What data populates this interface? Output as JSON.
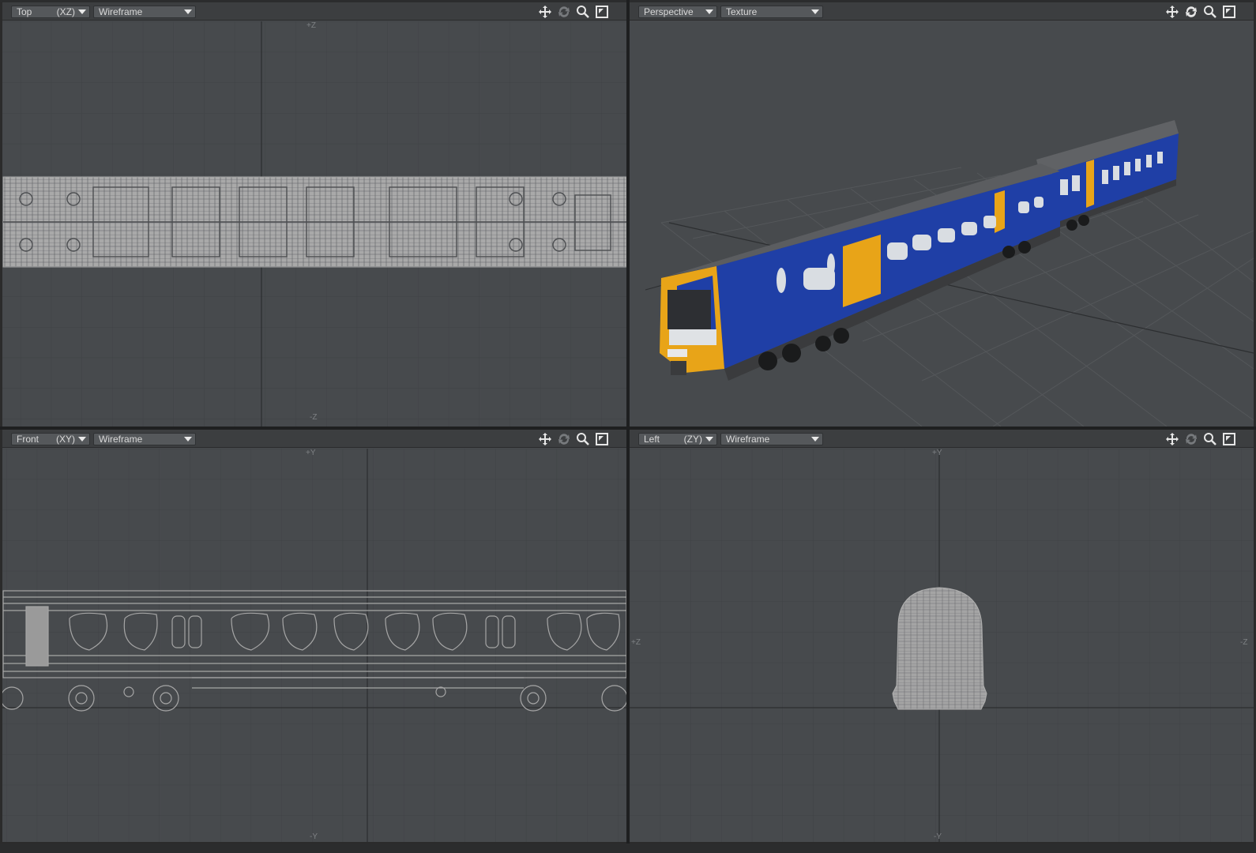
{
  "viewports": {
    "top": {
      "view_label": "Top",
      "projection": "(XZ)",
      "shading": "Wireframe",
      "axis_top": "+Z",
      "axis_bottom": "-Z"
    },
    "perspective": {
      "view_label": "Perspective",
      "shading": "Texture"
    },
    "front": {
      "view_label": "Front",
      "projection": "(XY)",
      "shading": "Wireframe",
      "axis_top": "+Y",
      "axis_bottom": "-Y"
    },
    "left": {
      "view_label": "Left",
      "projection": "(ZY)",
      "shading": "Wireframe",
      "axis_top": "+Y",
      "axis_left": "+Z",
      "axis_right": "-Z",
      "axis_bottom": "-Y"
    }
  },
  "icons": [
    "move-icon",
    "rotate-icon",
    "zoom-icon",
    "maximize-icon"
  ],
  "colors": {
    "viewport_bg": "#474a4d",
    "grid": "#3f4245",
    "wireframe": "#a6a6a6",
    "train_blue": "#1f3fa6",
    "train_yellow": "#e8a418",
    "train_roof": "#5b5d60"
  }
}
